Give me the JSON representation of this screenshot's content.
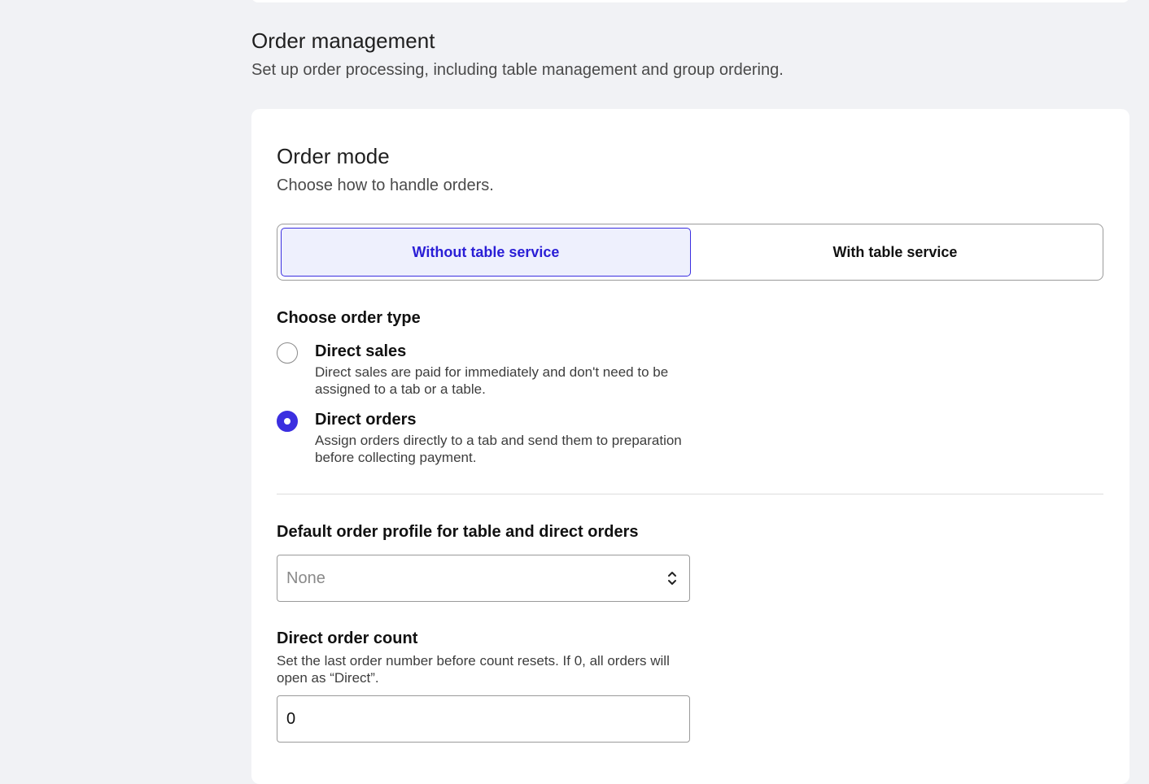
{
  "section": {
    "title": "Order management",
    "subtitle": "Set up order processing, including table management and group ordering."
  },
  "order_mode": {
    "title": "Order mode",
    "subtitle": "Choose how to handle orders.",
    "segments": [
      {
        "label": "Without table service",
        "active": true
      },
      {
        "label": "With table service",
        "active": false
      }
    ]
  },
  "order_type": {
    "label": "Choose order type",
    "options": [
      {
        "title": "Direct sales",
        "description": "Direct sales are paid for immediately and don't need to be assigned to a tab or a table.",
        "checked": false
      },
      {
        "title": "Direct orders",
        "description": "Assign orders directly to a tab and send them to preparation before collecting payment.",
        "checked": true
      }
    ]
  },
  "default_profile": {
    "label": "Default order profile for table and direct orders",
    "value": "None"
  },
  "direct_order_count": {
    "label": "Direct order count",
    "description": "Set the last order number before count resets. If 0, all orders will open as “Direct”.",
    "value": "0"
  },
  "colors": {
    "accent": "#3b2fe0",
    "active_segment_bg": "#eef0fd",
    "page_bg": "#f1f2f5"
  }
}
